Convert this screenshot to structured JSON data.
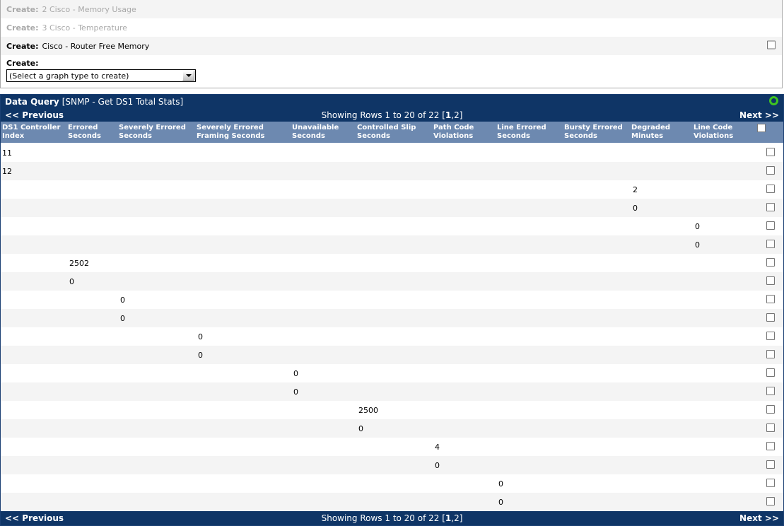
{
  "create_panel": {
    "rows": [
      {
        "label": "Create:",
        "text": "2 Cisco - Memory Usage",
        "disabled": true,
        "checkbox": false,
        "stripe": "alt"
      },
      {
        "label": "Create:",
        "text": "3 Cisco - Temperature",
        "disabled": true,
        "checkbox": false,
        "stripe": "plain"
      },
      {
        "label": "Create:",
        "text": "Cisco - Router Free Memory",
        "disabled": false,
        "checkbox": true,
        "stripe": "alt"
      }
    ],
    "form": {
      "label": "Create:",
      "select_value": "(Select a graph type to create)",
      "dropdown_icon": "chevron-down-icon"
    }
  },
  "data_query": {
    "title": "Data Query",
    "subtitle": "[SNMP - Get DS1 Total Stats]",
    "status_icon": "green-circle-icon",
    "nav": {
      "previous": "<< Previous",
      "next": "Next >>",
      "showing_prefix": "Showing Rows 1 to 20 of 22 [",
      "page_current": "1",
      "page_rest": ",2]"
    },
    "columns": [
      "DS1 Controller Index",
      "Errored Seconds",
      "Severely Errored Seconds",
      "Severely Errored Framing Seconds",
      "Unavailable Seconds",
      "Controlled Slip Seconds",
      "Path Code Violations",
      "Line Errored Seconds",
      "Bursty Errored Seconds",
      "Degraded Minutes",
      "Line Code Violations"
    ],
    "column_lines": [
      [
        "DS1 Controller",
        "Index"
      ],
      [
        "Errored",
        "Seconds"
      ],
      [
        "Severely Errored",
        "Seconds"
      ],
      [
        "Severely Errored",
        "Framing Seconds"
      ],
      [
        "Unavailable",
        "Seconds"
      ],
      [
        "Controlled Slip",
        "Seconds"
      ],
      [
        "Path Code",
        "Violations"
      ],
      [
        "Line Errored",
        "Seconds"
      ],
      [
        "Bursty Errored",
        "Seconds"
      ],
      [
        "Degraded",
        "Minutes"
      ],
      [
        "Line Code",
        "Violations"
      ]
    ],
    "rows": [
      [
        "11",
        "",
        "",
        "",
        "",
        "",
        "",
        "",
        "",
        "",
        ""
      ],
      [
        "12",
        "",
        "",
        "",
        "",
        "",
        "",
        "",
        "",
        "",
        ""
      ],
      [
        "",
        "",
        "",
        "",
        "",
        "",
        "",
        "",
        "",
        "2",
        ""
      ],
      [
        "",
        "",
        "",
        "",
        "",
        "",
        "",
        "",
        "",
        "0",
        ""
      ],
      [
        "",
        "",
        "",
        "",
        "",
        "",
        "",
        "",
        "",
        "",
        "0"
      ],
      [
        "",
        "",
        "",
        "",
        "",
        "",
        "",
        "",
        "",
        "",
        "0"
      ],
      [
        "",
        "2502",
        "",
        "",
        "",
        "",
        "",
        "",
        "",
        "",
        ""
      ],
      [
        "",
        "0",
        "",
        "",
        "",
        "",
        "",
        "",
        "",
        "",
        ""
      ],
      [
        "",
        "",
        "0",
        "",
        "",
        "",
        "",
        "",
        "",
        "",
        ""
      ],
      [
        "",
        "",
        "0",
        "",
        "",
        "",
        "",
        "",
        "",
        "",
        ""
      ],
      [
        "",
        "",
        "",
        "0",
        "",
        "",
        "",
        "",
        "",
        "",
        ""
      ],
      [
        "",
        "",
        "",
        "0",
        "",
        "",
        "",
        "",
        "",
        "",
        ""
      ],
      [
        "",
        "",
        "",
        "",
        "0",
        "",
        "",
        "",
        "",
        "",
        ""
      ],
      [
        "",
        "",
        "",
        "",
        "0",
        "",
        "",
        "",
        "",
        "",
        ""
      ],
      [
        "",
        "",
        "",
        "",
        "",
        "2500",
        "",
        "",
        "",
        "",
        ""
      ],
      [
        "",
        "",
        "",
        "",
        "",
        "0",
        "",
        "",
        "",
        "",
        ""
      ],
      [
        "",
        "",
        "",
        "",
        "",
        "",
        "4",
        "",
        "",
        "",
        ""
      ],
      [
        "",
        "",
        "",
        "",
        "",
        "",
        "0",
        "",
        "",
        "",
        ""
      ],
      [
        "",
        "",
        "",
        "",
        "",
        "",
        "",
        "0",
        "",
        "",
        ""
      ],
      [
        "",
        "",
        "",
        "",
        "",
        "",
        "",
        "0",
        "",
        "",
        ""
      ]
    ],
    "row_checkbox_icon": "checkbox-unchecked-icon",
    "select_all_icon": "checkbox-select-all-icon"
  },
  "colors": {
    "header_navy": "#0f3566",
    "column_header_blue": "#6d89b0",
    "row_alt": "#f4f4f4",
    "status_green": "#3fc421",
    "disabled_text": "#a9a9a9"
  }
}
